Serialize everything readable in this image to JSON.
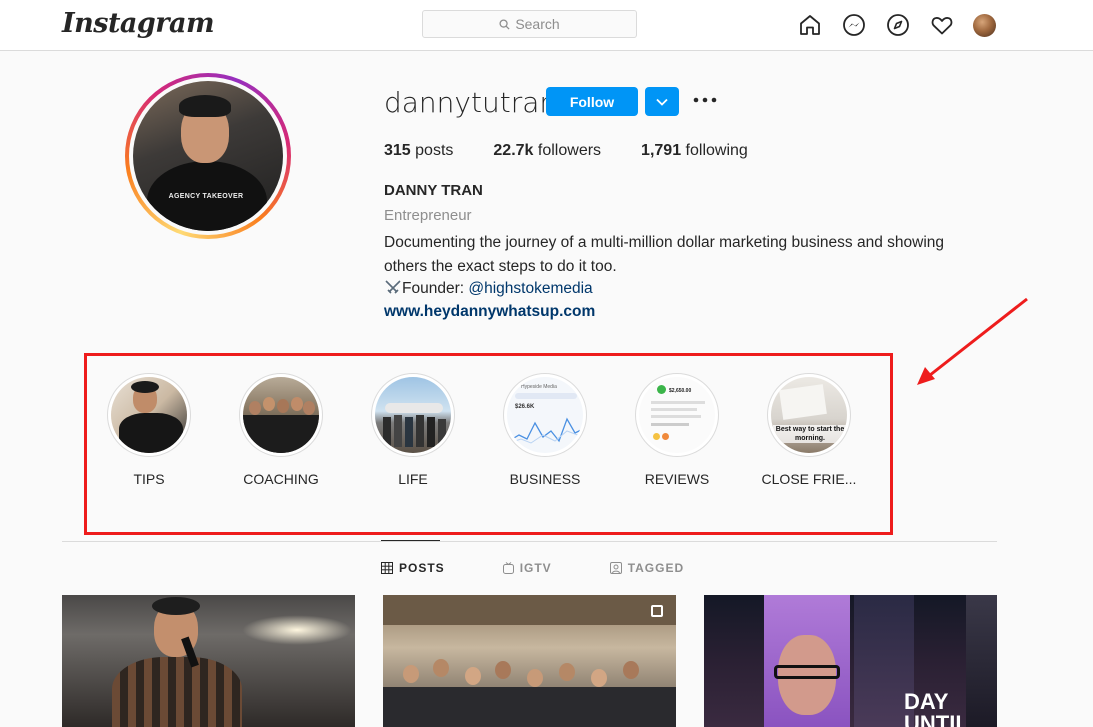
{
  "header": {
    "logo": "Instagram",
    "search_placeholder": "Search",
    "icons": [
      "home-icon",
      "messenger-icon",
      "explore-icon",
      "heart-icon",
      "profile-avatar"
    ]
  },
  "profile": {
    "username": "dannytutran",
    "follow_label": "Follow",
    "stats": {
      "posts_count": "315",
      "posts_label": "posts",
      "followers_count": "22.7k",
      "followers_label": "followers",
      "following_count": "1,791",
      "following_label": "following"
    },
    "full_name": "DANNY TRAN",
    "category": "Entrepreneur",
    "bio": "Documenting the journey of a multi-million dollar marketing business and showing others the exact steps to do it too.",
    "founder_prefix": "Founder: ",
    "founder_mention": "@highstokemedia",
    "website": "www.heydannywhatsup.com",
    "avatar_shirt_text": "AGENCY TAKEOVER"
  },
  "highlights": [
    {
      "label": "TIPS"
    },
    {
      "label": "COACHING"
    },
    {
      "label": "LIFE"
    },
    {
      "label": "BUSINESS"
    },
    {
      "label": "REVIEWS"
    },
    {
      "label": "CLOSE FRIE..."
    }
  ],
  "highlight_thumb_text": {
    "business_title": "Hypeside Media",
    "business_value": "$26.6K",
    "reviews_amount": "$2,650.00",
    "close_friends_caption": "Best way to start the morning."
  },
  "tabs": [
    {
      "label": "POSTS",
      "active": true
    },
    {
      "label": "IGTV",
      "active": false
    },
    {
      "label": "TAGGED",
      "active": false
    }
  ],
  "post_text": {
    "third_overlay": "DAY UNTIL"
  },
  "colors": {
    "accent": "#0095f6",
    "annotation_red": "#ee1c1c",
    "link": "#00376b"
  }
}
